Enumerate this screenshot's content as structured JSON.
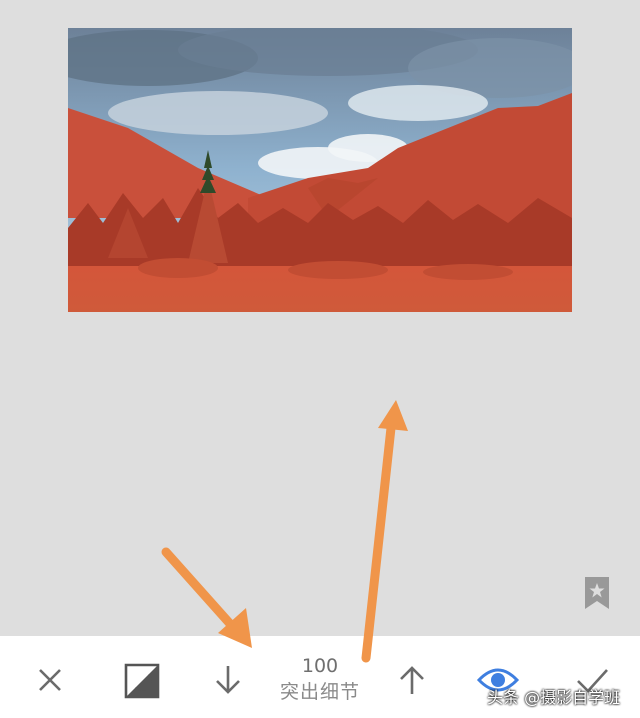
{
  "editor": {
    "value": "100",
    "parameter": "突出细节"
  },
  "toolbar": {
    "icons": [
      "close-icon",
      "mask-icon",
      "arrow-down-icon",
      "arrow-up-icon",
      "eye-icon",
      "check-icon"
    ]
  },
  "watermark": "头条 @摄影自学班",
  "colors": {
    "background": "#dedede",
    "toolbar": "#ffffff",
    "accent_eye": "#3f7fe0",
    "annotation_arrow": "#f0954a",
    "icon_gray": "#6b6b6b"
  }
}
